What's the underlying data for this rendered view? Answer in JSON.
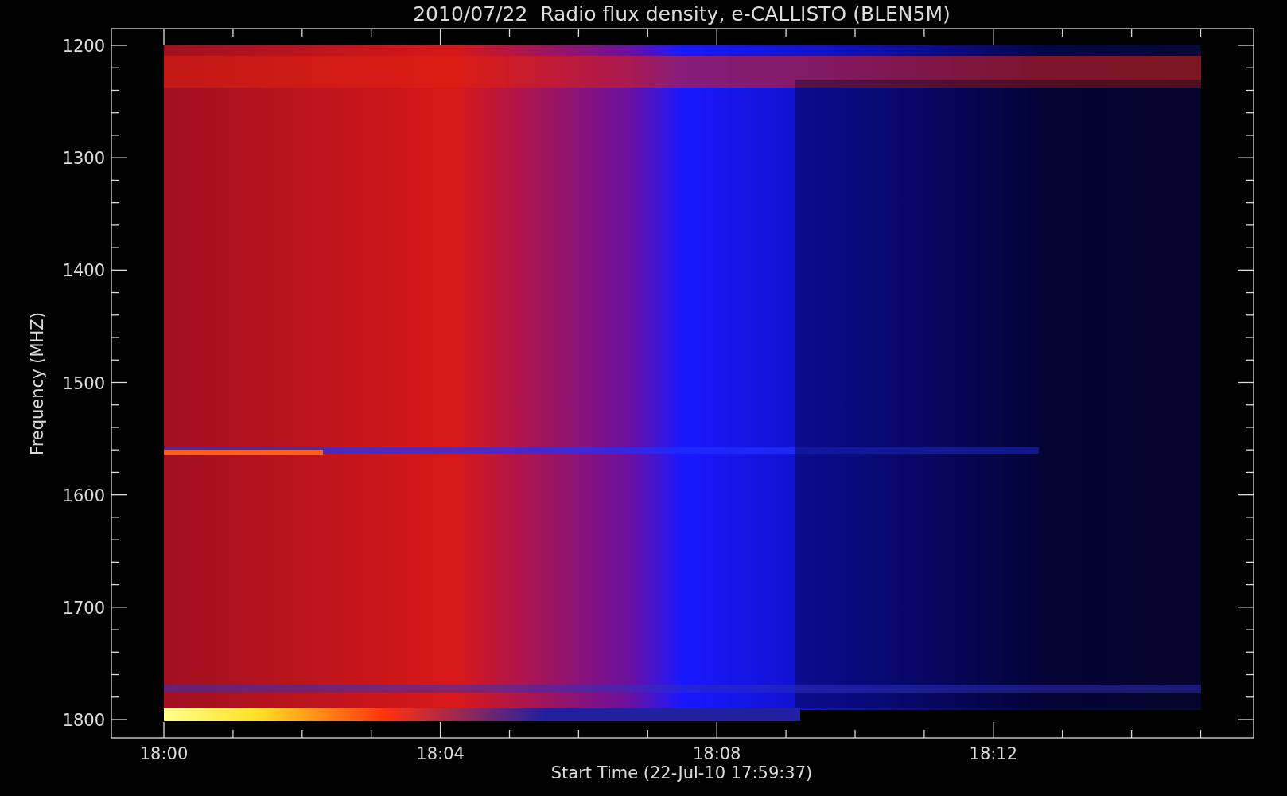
{
  "title": "2010/07/22  Radio flux density, e-CALLISTO (BLEN5M)",
  "y_axis": {
    "label": "Frequency (MHZ)",
    "ticks": [
      "1200",
      "1300",
      "1400",
      "1500",
      "1600",
      "1700",
      "1800"
    ]
  },
  "x_axis": {
    "label": "Start Time (22-Jul-10 17:59:37)",
    "ticks": [
      "18:00",
      "18:04",
      "18:08",
      "18:12"
    ]
  }
}
